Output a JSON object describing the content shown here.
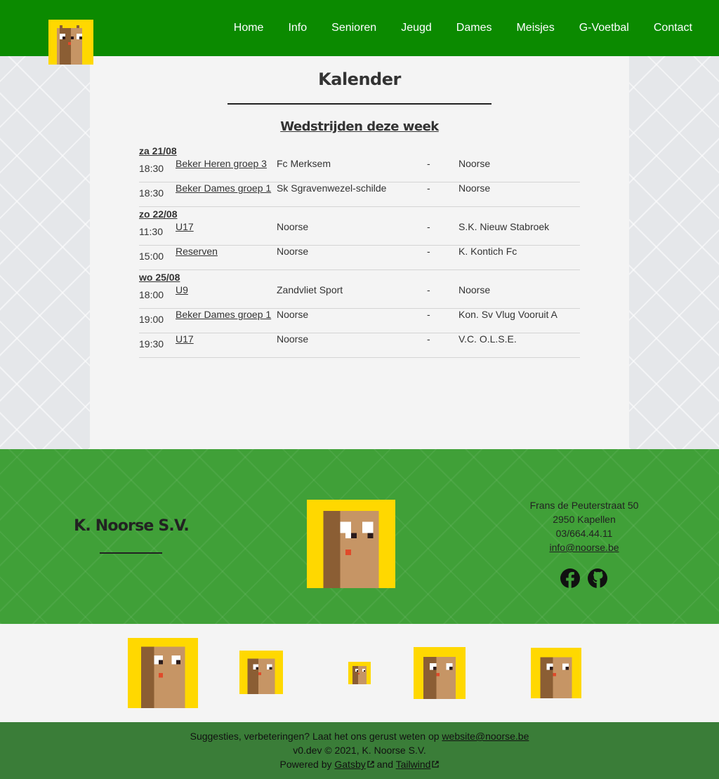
{
  "nav": {
    "items": [
      "Home",
      "Info",
      "Senioren",
      "Jeugd",
      "Dames",
      "Meisjes",
      "G-Voetbal",
      "Contact"
    ]
  },
  "main": {
    "title": "Kalender",
    "section_title": "Wedstrijden deze week",
    "days": [
      {
        "label": "za 21/08",
        "matches": [
          {
            "time": "18:30",
            "competition": "Beker Heren groep 3",
            "home": "Fc Merksem",
            "sep": "-",
            "away": "Noorse"
          },
          {
            "time": "18:30",
            "competition": "Beker Dames groep 1",
            "home": "Sk Sgravenwezel-schilde",
            "sep": "-",
            "away": "Noorse"
          }
        ]
      },
      {
        "label": "zo 22/08",
        "matches": [
          {
            "time": "11:30",
            "competition": "U17",
            "home": "Noorse",
            "sep": "-",
            "away": "S.K. Nieuw Stabroek"
          },
          {
            "time": "15:00",
            "competition": "Reserven",
            "home": "Noorse",
            "sep": "-",
            "away": "K. Kontich Fc"
          }
        ]
      },
      {
        "label": "wo 25/08",
        "matches": [
          {
            "time": "18:00",
            "competition": "U9",
            "home": "Zandvliet Sport",
            "sep": "-",
            "away": "Noorse"
          },
          {
            "time": "19:00",
            "competition": "Beker Dames groep 1",
            "home": "Noorse",
            "sep": "-",
            "away": "Kon. Sv Vlug Vooruit A"
          },
          {
            "time": "19:30",
            "competition": "U17",
            "home": "Noorse",
            "sep": "-",
            "away": "V.C. O.L.S.E."
          }
        ]
      }
    ]
  },
  "footer": {
    "club_name": "K. Noorse S.V.",
    "address_line1": "Frans de Peuterstraat 50",
    "address_line2": "2950 Kapellen",
    "phone": "03/664.44.11",
    "email": "info@noorse.be",
    "social_icons": [
      "facebook-icon",
      "github-icon"
    ]
  },
  "bottom": {
    "suggestion_text": "Suggesties, verbeteringen? Laat het ons gerust weten op",
    "suggestion_email": "website@noorse.be",
    "version_line": "v0.dev © 2021, K. Noorse S.V.",
    "powered_by": "Powered by",
    "gatsby": "Gatsby",
    "and": "and",
    "tailwind": "Tailwind"
  },
  "colors": {
    "header_bg": "#0b8a00",
    "footer_bg": "#40a038",
    "bottom_bg": "#3a7d38",
    "logo_yellow": "#ffd800",
    "logo_brown": "#8b5e34"
  }
}
